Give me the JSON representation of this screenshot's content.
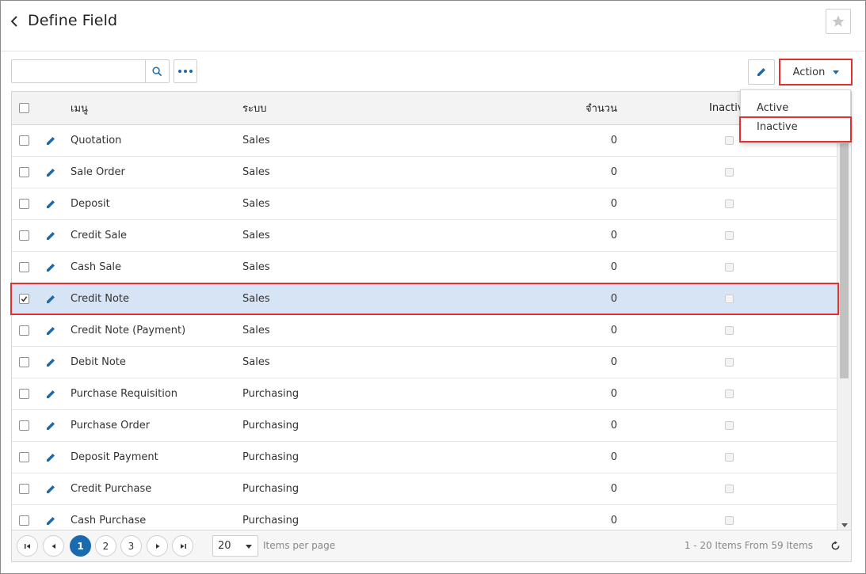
{
  "header": {
    "title": "Define Field"
  },
  "toolbar": {
    "search_placeholder": "",
    "action_label": "Action"
  },
  "action_menu": {
    "items": [
      "Active",
      "Inactive"
    ]
  },
  "table": {
    "columns": {
      "menu": "เมนู",
      "system": "ระบบ",
      "quantity": "จำนวน",
      "inactive": "Inactive"
    },
    "rows": [
      {
        "menu": "Quotation",
        "system": "Sales",
        "quantity": "0",
        "checked": false
      },
      {
        "menu": "Sale Order",
        "system": "Sales",
        "quantity": "0",
        "checked": false
      },
      {
        "menu": "Deposit",
        "system": "Sales",
        "quantity": "0",
        "checked": false
      },
      {
        "menu": "Credit Sale",
        "system": "Sales",
        "quantity": "0",
        "checked": false
      },
      {
        "menu": "Cash Sale",
        "system": "Sales",
        "quantity": "0",
        "checked": false
      },
      {
        "menu": "Credit Note",
        "system": "Sales",
        "quantity": "0",
        "checked": true
      },
      {
        "menu": "Credit Note (Payment)",
        "system": "Sales",
        "quantity": "0",
        "checked": false
      },
      {
        "menu": "Debit Note",
        "system": "Sales",
        "quantity": "0",
        "checked": false
      },
      {
        "menu": "Purchase Requisition",
        "system": "Purchasing",
        "quantity": "0",
        "checked": false
      },
      {
        "menu": "Purchase Order",
        "system": "Purchasing",
        "quantity": "0",
        "checked": false
      },
      {
        "menu": "Deposit Payment",
        "system": "Purchasing",
        "quantity": "0",
        "checked": false
      },
      {
        "menu": "Credit Purchase",
        "system": "Purchasing",
        "quantity": "0",
        "checked": false
      },
      {
        "menu": "Cash Purchase",
        "system": "Purchasing",
        "quantity": "0",
        "checked": false
      }
    ]
  },
  "pager": {
    "pages": [
      "1",
      "2",
      "3"
    ],
    "current_page": "1",
    "page_size": "20",
    "items_per_page_label": "Items per page",
    "summary": "1 - 20 Items From 59 Items"
  },
  "colors": {
    "accent": "#1a6aad",
    "highlight": "#e03030",
    "selected_row": "#d6e4f5"
  }
}
